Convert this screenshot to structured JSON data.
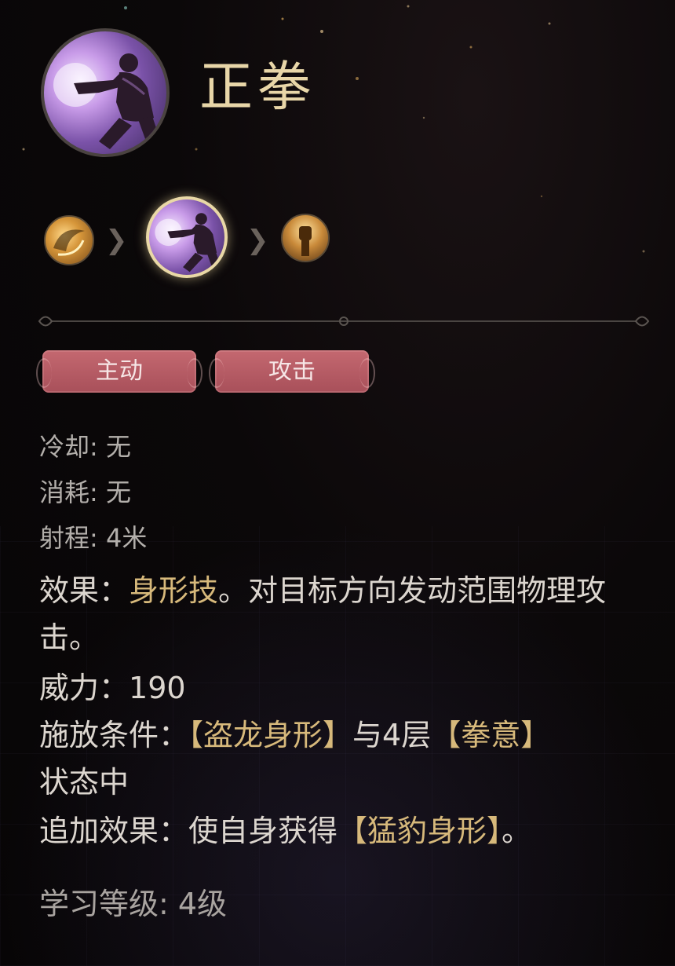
{
  "skill": {
    "name": "正拳",
    "icon": "fist-punch-icon"
  },
  "chain": {
    "nodes": [
      {
        "icon": "golden-swirl-icon",
        "active": false
      },
      {
        "icon": "fist-punch-icon",
        "active": true
      },
      {
        "icon": "raised-fist-icon",
        "active": false
      }
    ]
  },
  "tags": [
    "主动",
    "攻击"
  ],
  "stats": {
    "cooldown": "冷却: 无",
    "cost": "消耗: 无",
    "range": "射程: 4米"
  },
  "effect": {
    "label": "效果：",
    "highlight": "身形技",
    "text": "。对目标方向发动范围物理攻击。"
  },
  "power": {
    "label": "威力：",
    "value": "190"
  },
  "condition": {
    "label": "施放条件：",
    "part1": "【盗龙身形】",
    "middle": "与4层",
    "part2": "【拳意】",
    "suffix": "状态中"
  },
  "extra_effect": {
    "label": "追加效果：",
    "text": "使自身获得",
    "highlight": "【猛豹身形】",
    "suffix": "。"
  },
  "learn_level": "学习等级:  4级",
  "colors": {
    "title": "#e8d6a8",
    "highlight": "#d7b97b",
    "tag_bg": "#b85a63"
  }
}
